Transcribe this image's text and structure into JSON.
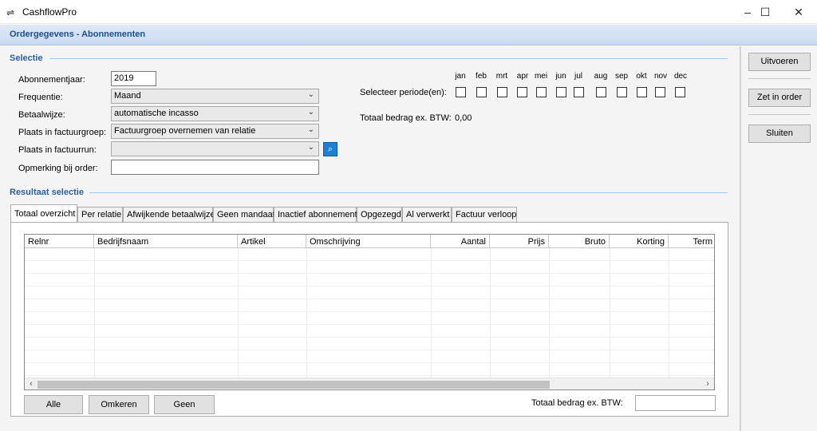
{
  "window": {
    "title": "CashflowPro",
    "minimize": "–",
    "maximize": "☐",
    "close": "✕"
  },
  "form_header": "Ordergegevens - Abonnementen",
  "selectie": {
    "title": "Selectie",
    "abonnementjaar_label": "Abonnementjaar:",
    "abonnementjaar_value": "2019",
    "frequentie_label": "Frequentie:",
    "frequentie_value": "Maand",
    "betaalwijze_label": "Betaalwijze:",
    "betaalwijze_value": "automatische incasso",
    "factuurgroep_label": "Plaats in factuurgroep:",
    "factuurgroep_value": "Factuurgroep overnemen van relatie",
    "factuurrun_label": "Plaats in factuurrun:",
    "factuurrun_value": "",
    "opmerking_label": "Opmerking bij order:",
    "opmerking_value": "",
    "periode_label": "Selecteer periode(en):",
    "months": [
      "jan",
      "feb",
      "mrt",
      "apr",
      "mei",
      "jun",
      "jul",
      "aug",
      "sep",
      "okt",
      "nov",
      "dec"
    ],
    "totaal_label": "Totaal bedrag ex. BTW:",
    "totaal_value": "0,00"
  },
  "resultaat": {
    "title": "Resultaat selectie",
    "tabs": [
      "Totaal overzicht",
      "Per relatie",
      "Afwijkende betaalwijze",
      "Geen mandaat",
      "Inactief abonnement",
      "Opgezegd",
      "Al verwerkt",
      "Factuur verloop"
    ],
    "active_tab": 0,
    "columns": [
      "Relnr",
      "Bedrijfsnaam",
      "Artikel",
      "Omschrijving",
      "Aantal",
      "Prijs",
      "Bruto",
      "Korting",
      "Term"
    ],
    "rows": [],
    "buttons": {
      "alle": "Alle",
      "omkeren": "Omkeren",
      "geen": "Geen"
    },
    "totaal_label": "Totaal bedrag ex. BTW:",
    "totaal_value": ""
  },
  "side": {
    "uitvoeren": "Uitvoeren",
    "zet_in_order": "Zet in order",
    "sluiten": "Sluiten"
  }
}
